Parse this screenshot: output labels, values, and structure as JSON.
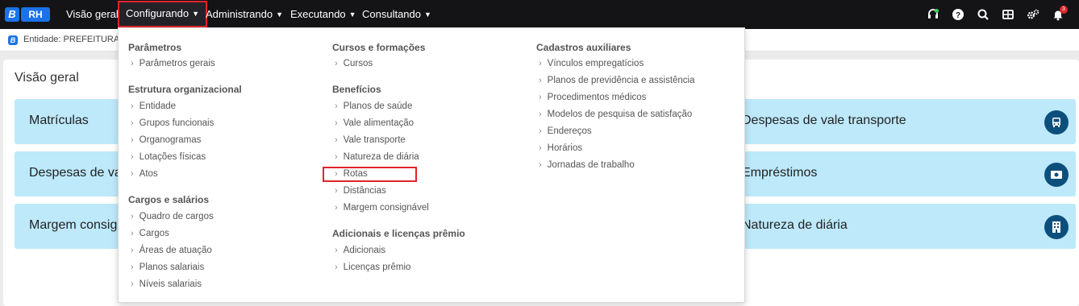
{
  "app": {
    "logo_letter": "B",
    "logo_label": "RH"
  },
  "nav": {
    "items": [
      "Visão geral",
      "Configurando",
      "Administrando",
      "Executando",
      "Consultando"
    ],
    "active": "Configurando"
  },
  "topbar_icons": [
    "headset-icon",
    "help-icon",
    "search-icon",
    "grid-icon",
    "settings-icon",
    "bell-icon"
  ],
  "notification_count": "3",
  "entity": {
    "label": "Entidade: PREFEITURA D"
  },
  "main": {
    "title": "Visão geral",
    "tiles": [
      {
        "label": "Matrículas",
        "icon": ""
      },
      {
        "label": "Despesas de vale transporte",
        "icon": "bus-icon"
      },
      {
        "label": "Despesas de val",
        "icon": ""
      },
      {
        "label": "Empréstimos",
        "icon": "money-icon"
      },
      {
        "label": "Margem consign",
        "icon": ""
      },
      {
        "label": "Natureza de diária",
        "icon": "building-icon"
      }
    ]
  },
  "dropdown": {
    "columns": [
      {
        "sections": [
          {
            "title": "Parâmetros",
            "items": [
              "Parâmetros gerais"
            ]
          },
          {
            "title": "Estrutura organizacional",
            "items": [
              "Entidade",
              "Grupos funcionais",
              "Organogramas",
              "Lotações físicas",
              "Atos"
            ]
          },
          {
            "title": "Cargos e salários",
            "items": [
              "Quadro de cargos",
              "Cargos",
              "Áreas de atuação",
              "Planos salariais",
              "Níveis salariais"
            ]
          }
        ]
      },
      {
        "sections": [
          {
            "title": "Cursos e formações",
            "items": [
              "Cursos"
            ]
          },
          {
            "title": "Benefícios",
            "items": [
              "Planos de saúde",
              "Vale alimentação",
              "Vale transporte",
              "Natureza de diária",
              "Rotas",
              "Distâncias",
              "Margem consignável"
            ]
          },
          {
            "title": "Adicionais e licenças prêmio",
            "items": [
              "Adicionais",
              "Licenças prêmio"
            ]
          }
        ]
      },
      {
        "sections": [
          {
            "title": "Cadastros auxiliares",
            "items": [
              "Vínculos empregatícios",
              "Planos de previdência e assistência",
              "Procedimentos médicos",
              "Modelos de pesquisa de satisfação",
              "Endereços",
              "Horários",
              "Jornadas de trabalho"
            ]
          }
        ]
      }
    ],
    "highlighted_item": "Rotas"
  },
  "colors": {
    "topbar": "#141416",
    "accent": "#1a73e8",
    "tile": "#bde9fb",
    "tile_icon": "#0d4f7c",
    "highlight": "#e0242b"
  }
}
